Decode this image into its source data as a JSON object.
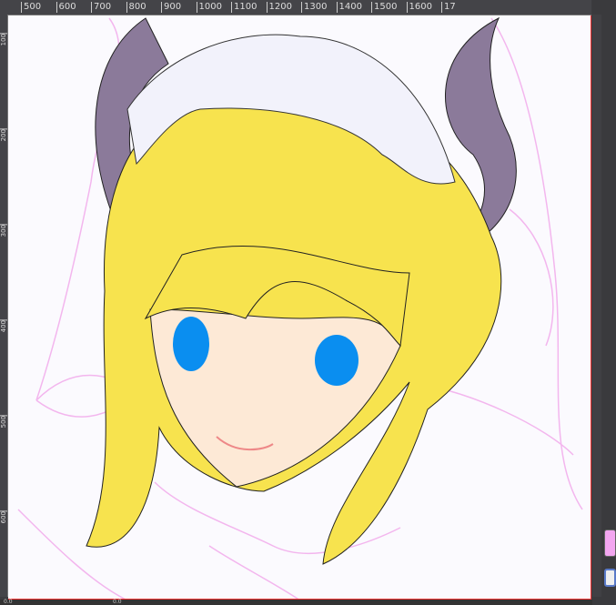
{
  "rulers": {
    "horizontal": [
      "500",
      "600",
      "700",
      "800",
      "900",
      "1000",
      "1100",
      "1200",
      "1300",
      "1400",
      "1500",
      "1600",
      "17"
    ],
    "vertical": [
      "100",
      "200",
      "300",
      "400",
      "500",
      "600"
    ]
  },
  "status": {
    "left_value": "0.0",
    "right_value": "0.0"
  },
  "colors": {
    "hair": "#f7e34e",
    "horn": "#8b7a9a",
    "skin": "#fde9d6",
    "eye": "#0a8ef0",
    "sketch": "#f3a6f0",
    "swatch": "#f3a6f0"
  }
}
